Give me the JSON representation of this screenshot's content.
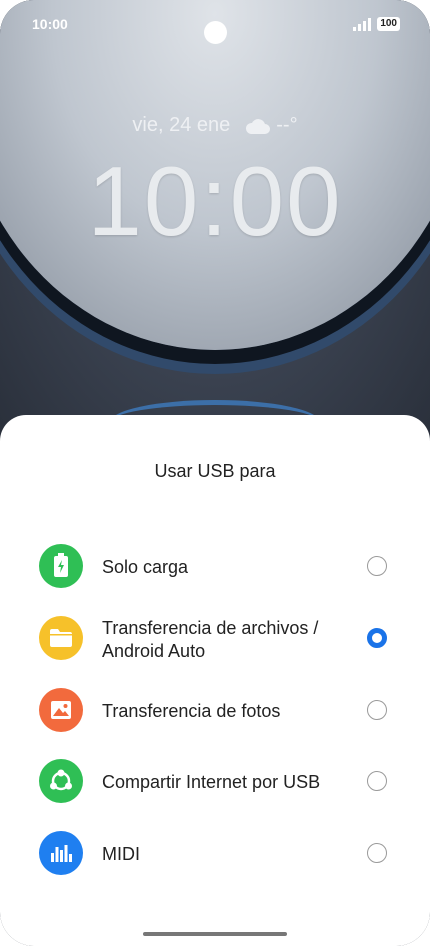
{
  "status_bar": {
    "time": "10:00",
    "battery": "100"
  },
  "lockscreen": {
    "date": "vie, 24 ene",
    "weather_temp": "--°",
    "clock": "10:00"
  },
  "sheet": {
    "title": "Usar USB para",
    "options": [
      {
        "label": "Solo carga",
        "icon": "battery-charging-icon",
        "color": "#2fbf55",
        "selected": false
      },
      {
        "label_line1": "Transferencia de archivos /",
        "label_line2": "Android Auto",
        "icon": "folder-icon",
        "color": "#f6c12a",
        "selected": true
      },
      {
        "label": "Transferencia de fotos",
        "icon": "photo-icon",
        "color": "#f26a3d",
        "selected": false
      },
      {
        "label": "Compartir Internet por USB",
        "icon": "tethering-icon",
        "color": "#2fbf55",
        "selected": false
      },
      {
        "label": "MIDI",
        "icon": "midi-equalizer-icon",
        "color": "#1f7ff0",
        "selected": false
      }
    ]
  }
}
